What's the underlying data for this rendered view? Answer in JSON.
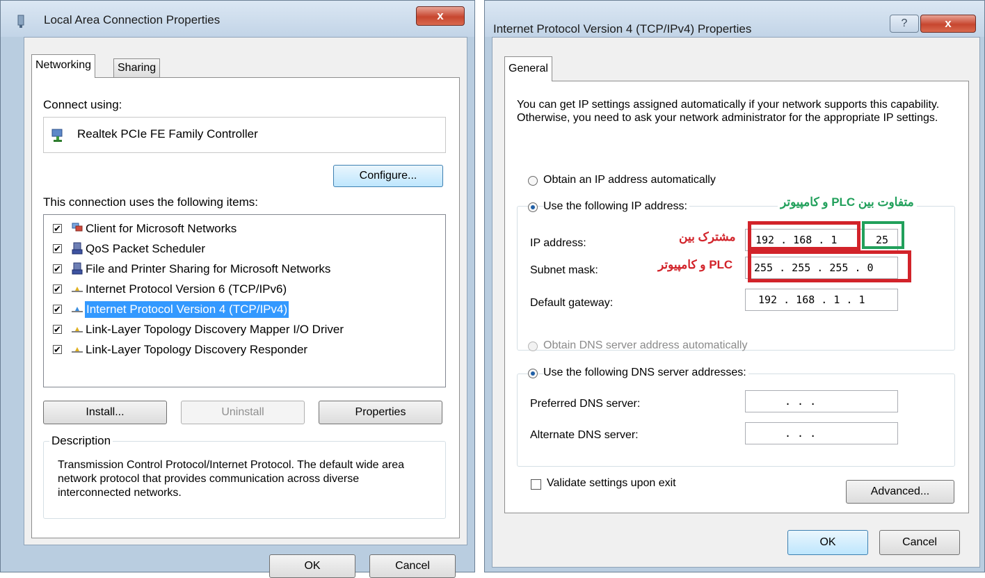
{
  "left_dialog": {
    "title": "Local Area Connection Properties",
    "close_glyph": "x",
    "tabs": [
      {
        "label": "Networking",
        "active": true
      },
      {
        "label": "Sharing",
        "active": false
      }
    ],
    "connect_using_label": "Connect using:",
    "adapter_name": "Realtek PCIe FE Family Controller",
    "configure_button": "Configure...",
    "items_label": "This connection uses the following items:",
    "items": [
      {
        "label": "Client for Microsoft Networks",
        "checked": true,
        "icon": "network-client-icon",
        "selected": false
      },
      {
        "label": "QoS Packet Scheduler",
        "checked": true,
        "icon": "network-service-icon",
        "selected": false
      },
      {
        "label": "File and Printer Sharing for Microsoft Networks",
        "checked": true,
        "icon": "network-service-icon",
        "selected": false
      },
      {
        "label": "Internet Protocol Version 6 (TCP/IPv6)",
        "checked": true,
        "icon": "protocol-icon",
        "selected": false
      },
      {
        "label": "Internet Protocol Version 4 (TCP/IPv4)",
        "checked": true,
        "icon": "protocol-icon",
        "selected": true
      },
      {
        "label": "Link-Layer Topology Discovery Mapper I/O Driver",
        "checked": true,
        "icon": "protocol-icon",
        "selected": false
      },
      {
        "label": "Link-Layer Topology Discovery Responder",
        "checked": true,
        "icon": "protocol-icon",
        "selected": false
      }
    ],
    "install_button": "Install...",
    "uninstall_button": "Uninstall",
    "properties_button": "Properties",
    "description_legend": "Description",
    "description_text": "Transmission Control Protocol/Internet Protocol. The default wide area network protocol that provides communication across diverse interconnected networks.",
    "ok_button": "OK",
    "cancel_button": "Cancel"
  },
  "right_dialog": {
    "title": "Internet Protocol Version 4 (TCP/IPv4) Properties",
    "help_glyph": "?",
    "close_glyph": "x",
    "tab": "General",
    "intro_text": "You can get IP settings assigned automatically if your network supports this capability. Otherwise, you need to ask your network administrator for the appropriate IP settings.",
    "radio_obtain_ip": "Obtain an IP address automatically",
    "radio_use_ip": "Use the following IP address:",
    "ip_label": "IP address:",
    "ip_prefix": "192 . 168 .  1",
    "ip_host": "25",
    "subnet_label": "Subnet mask:",
    "subnet_value": "255 . 255 . 255 .  0",
    "gateway_label": "Default gateway:",
    "gateway_value": "192 . 168 .  1  .  1",
    "radio_obtain_dns": "Obtain DNS server address automatically",
    "radio_use_dns": "Use the following DNS server addresses:",
    "preferred_dns_label": "Preferred DNS server:",
    "preferred_dns_value": ".     .     .",
    "alternate_dns_label": "Alternate DNS server:",
    "alternate_dns_value": ".     .     .",
    "validate_label": "Validate settings upon exit",
    "advanced_button": "Advanced...",
    "ok_button": "OK",
    "cancel_button": "Cancel"
  },
  "annotations": {
    "different_text": "متفاوت بین PLC و کامپیوتر",
    "common_line1": "مشترک بین",
    "common_line2": "PLC و کامپیوتر",
    "red_color": "#d2232a",
    "green_color": "#21a05b"
  }
}
